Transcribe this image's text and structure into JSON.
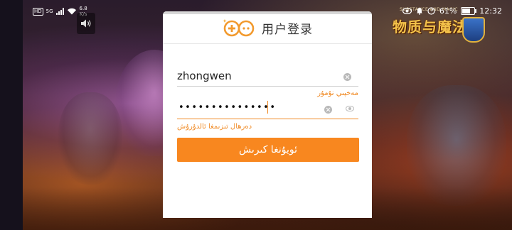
{
  "status_bar": {
    "hd": "HD",
    "network": "5G",
    "speed_value": "6.8",
    "speed_unit": "K/s",
    "battery": "61%",
    "time": "12:32"
  },
  "game": {
    "logo_text": "物质与魔法",
    "logo_sub": "SUBSTANCE AND MAGIC"
  },
  "dialog": {
    "title": "用户登录",
    "username": "zhongwen",
    "password_mask": "•••••••••••••••",
    "forgot_password": "مەخپىي نۇمۇر",
    "register": "دەرھال تىزىمغا ئالدۇرۇش",
    "login_button": "ئويۇنغا كىرىش"
  },
  "colors": {
    "accent": "#f8871f",
    "link": "#f08a24",
    "logo_orange": "#f29a2e",
    "logo_border": "#f5a742"
  },
  "icons": [
    "volume-icon",
    "game-controller-logo-icon",
    "clear-icon",
    "eye-icon",
    "battery-icon",
    "wifi-icon",
    "eye-status-icon",
    "alarm-icon"
  ]
}
